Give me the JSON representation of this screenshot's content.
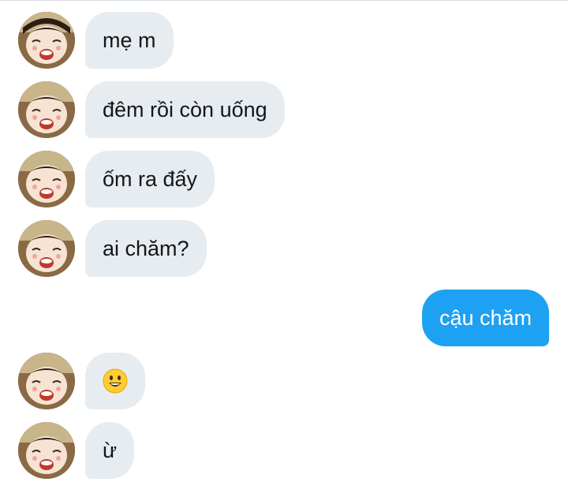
{
  "conversation": {
    "messages": [
      {
        "sender": "them",
        "text": "mẹ m"
      },
      {
        "sender": "them",
        "text": "đêm rồi còn uống"
      },
      {
        "sender": "them",
        "text": "ốm ra đấy"
      },
      {
        "sender": "them",
        "text": "ai chăm?"
      },
      {
        "sender": "me",
        "text": "cậu chăm"
      },
      {
        "sender": "them",
        "emoji": "grinning-face-icon"
      },
      {
        "sender": "them",
        "text": "ừ"
      }
    ]
  },
  "colors": {
    "incoming_bubble": "#e6ecf0",
    "outgoing_bubble": "#1da1f2",
    "incoming_text": "#14171a",
    "outgoing_text": "#ffffff"
  }
}
